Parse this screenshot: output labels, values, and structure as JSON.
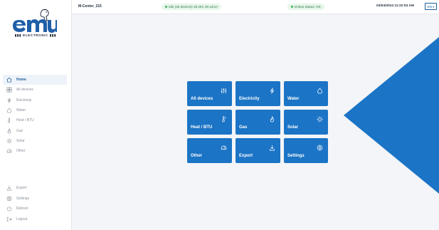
{
  "brand": {
    "tagline": "ELECTRONIC"
  },
  "topbar": {
    "device_name": "M-Center_215",
    "status_idle": "Idle (25 devices) 39.29V 28.12mA",
    "status_mbus": "M-Bus Status: OK",
    "datetime": "03/04/2024 11:22:53 AM",
    "language": "EN"
  },
  "sidebar": {
    "items": [
      {
        "label": "Home",
        "icon": "home-icon",
        "active": true
      },
      {
        "label": "All devices",
        "icon": "devices-icon"
      },
      {
        "label": "Electricity",
        "icon": "lightning-icon"
      },
      {
        "label": "Water",
        "icon": "water-drop-icon"
      },
      {
        "label": "Heat / BTU",
        "icon": "thermometer-icon"
      },
      {
        "label": "Gas",
        "icon": "flame-icon"
      },
      {
        "label": "Solar",
        "icon": "sun-icon"
      },
      {
        "label": "Other",
        "icon": "gauge-icon"
      }
    ],
    "bottom_items": [
      {
        "label": "Export",
        "icon": "export-icon"
      },
      {
        "label": "Settings",
        "icon": "gear-icon"
      },
      {
        "label": "Reboot",
        "icon": "power-icon"
      },
      {
        "label": "Logout",
        "icon": "logout-icon"
      }
    ]
  },
  "tiles": [
    {
      "label": "All devices",
      "icon": "sliders-icon"
    },
    {
      "label": "Electricity",
      "icon": "lightning-icon"
    },
    {
      "label": "Water",
      "icon": "water-drop-icon"
    },
    {
      "label": "Heat / BTU",
      "icon": "thermometer-icon"
    },
    {
      "label": "Gas",
      "icon": "flame-icon"
    },
    {
      "label": "Solar",
      "icon": "sun-icon"
    },
    {
      "label": "Other",
      "icon": "gauge-icon"
    },
    {
      "label": "Export",
      "icon": "export-icon"
    },
    {
      "label": "Settings",
      "icon": "gear-icon"
    }
  ],
  "colors": {
    "accent": "#1b74c5",
    "active_nav": "#1b5e9e",
    "status_bg": "#e7f6ea",
    "status_text": "#2e7d46"
  }
}
